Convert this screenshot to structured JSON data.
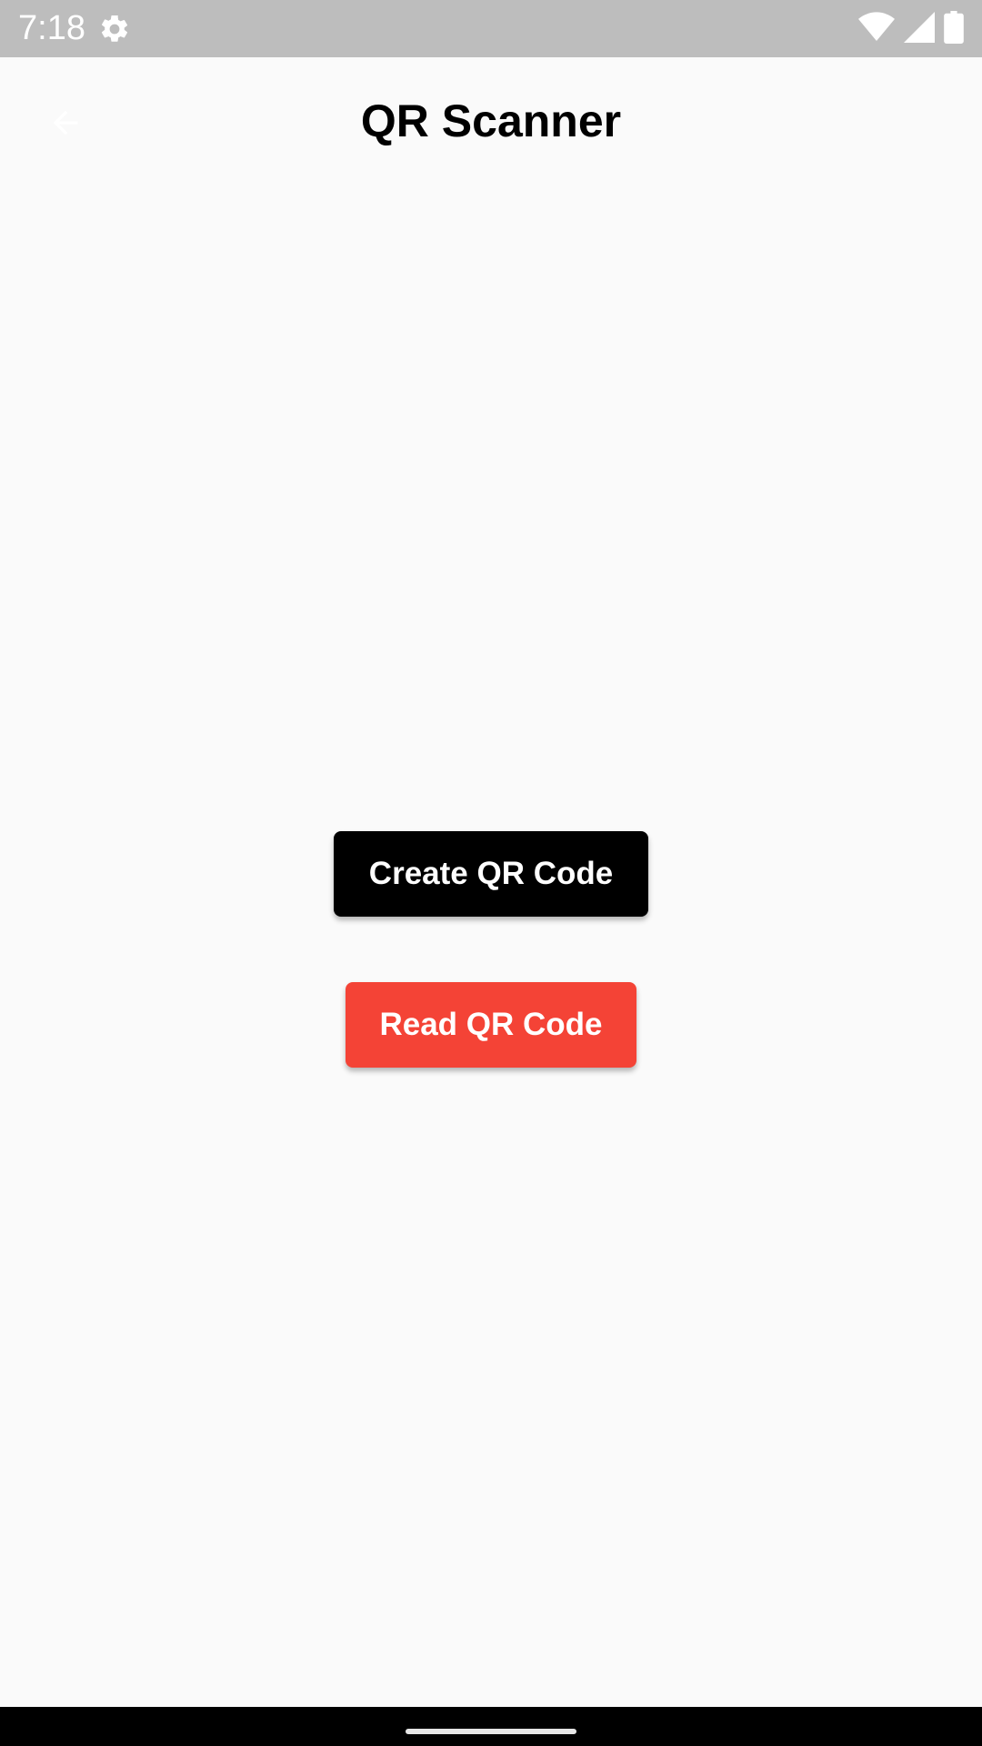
{
  "status_bar": {
    "time": "7:18",
    "icons": [
      "gear-icon",
      "wifi-icon",
      "cell-signal-icon",
      "battery-icon"
    ]
  },
  "header": {
    "title": "QR Scanner",
    "back_icon": "arrow-left-icon"
  },
  "actions": {
    "create_label": "Create QR Code",
    "read_label": "Read QR Code"
  },
  "colors": {
    "status_bar": "#bdbdbd",
    "background": "#fafafa",
    "create_button": "#000000",
    "read_button": "#f44336",
    "title": "#000000"
  }
}
